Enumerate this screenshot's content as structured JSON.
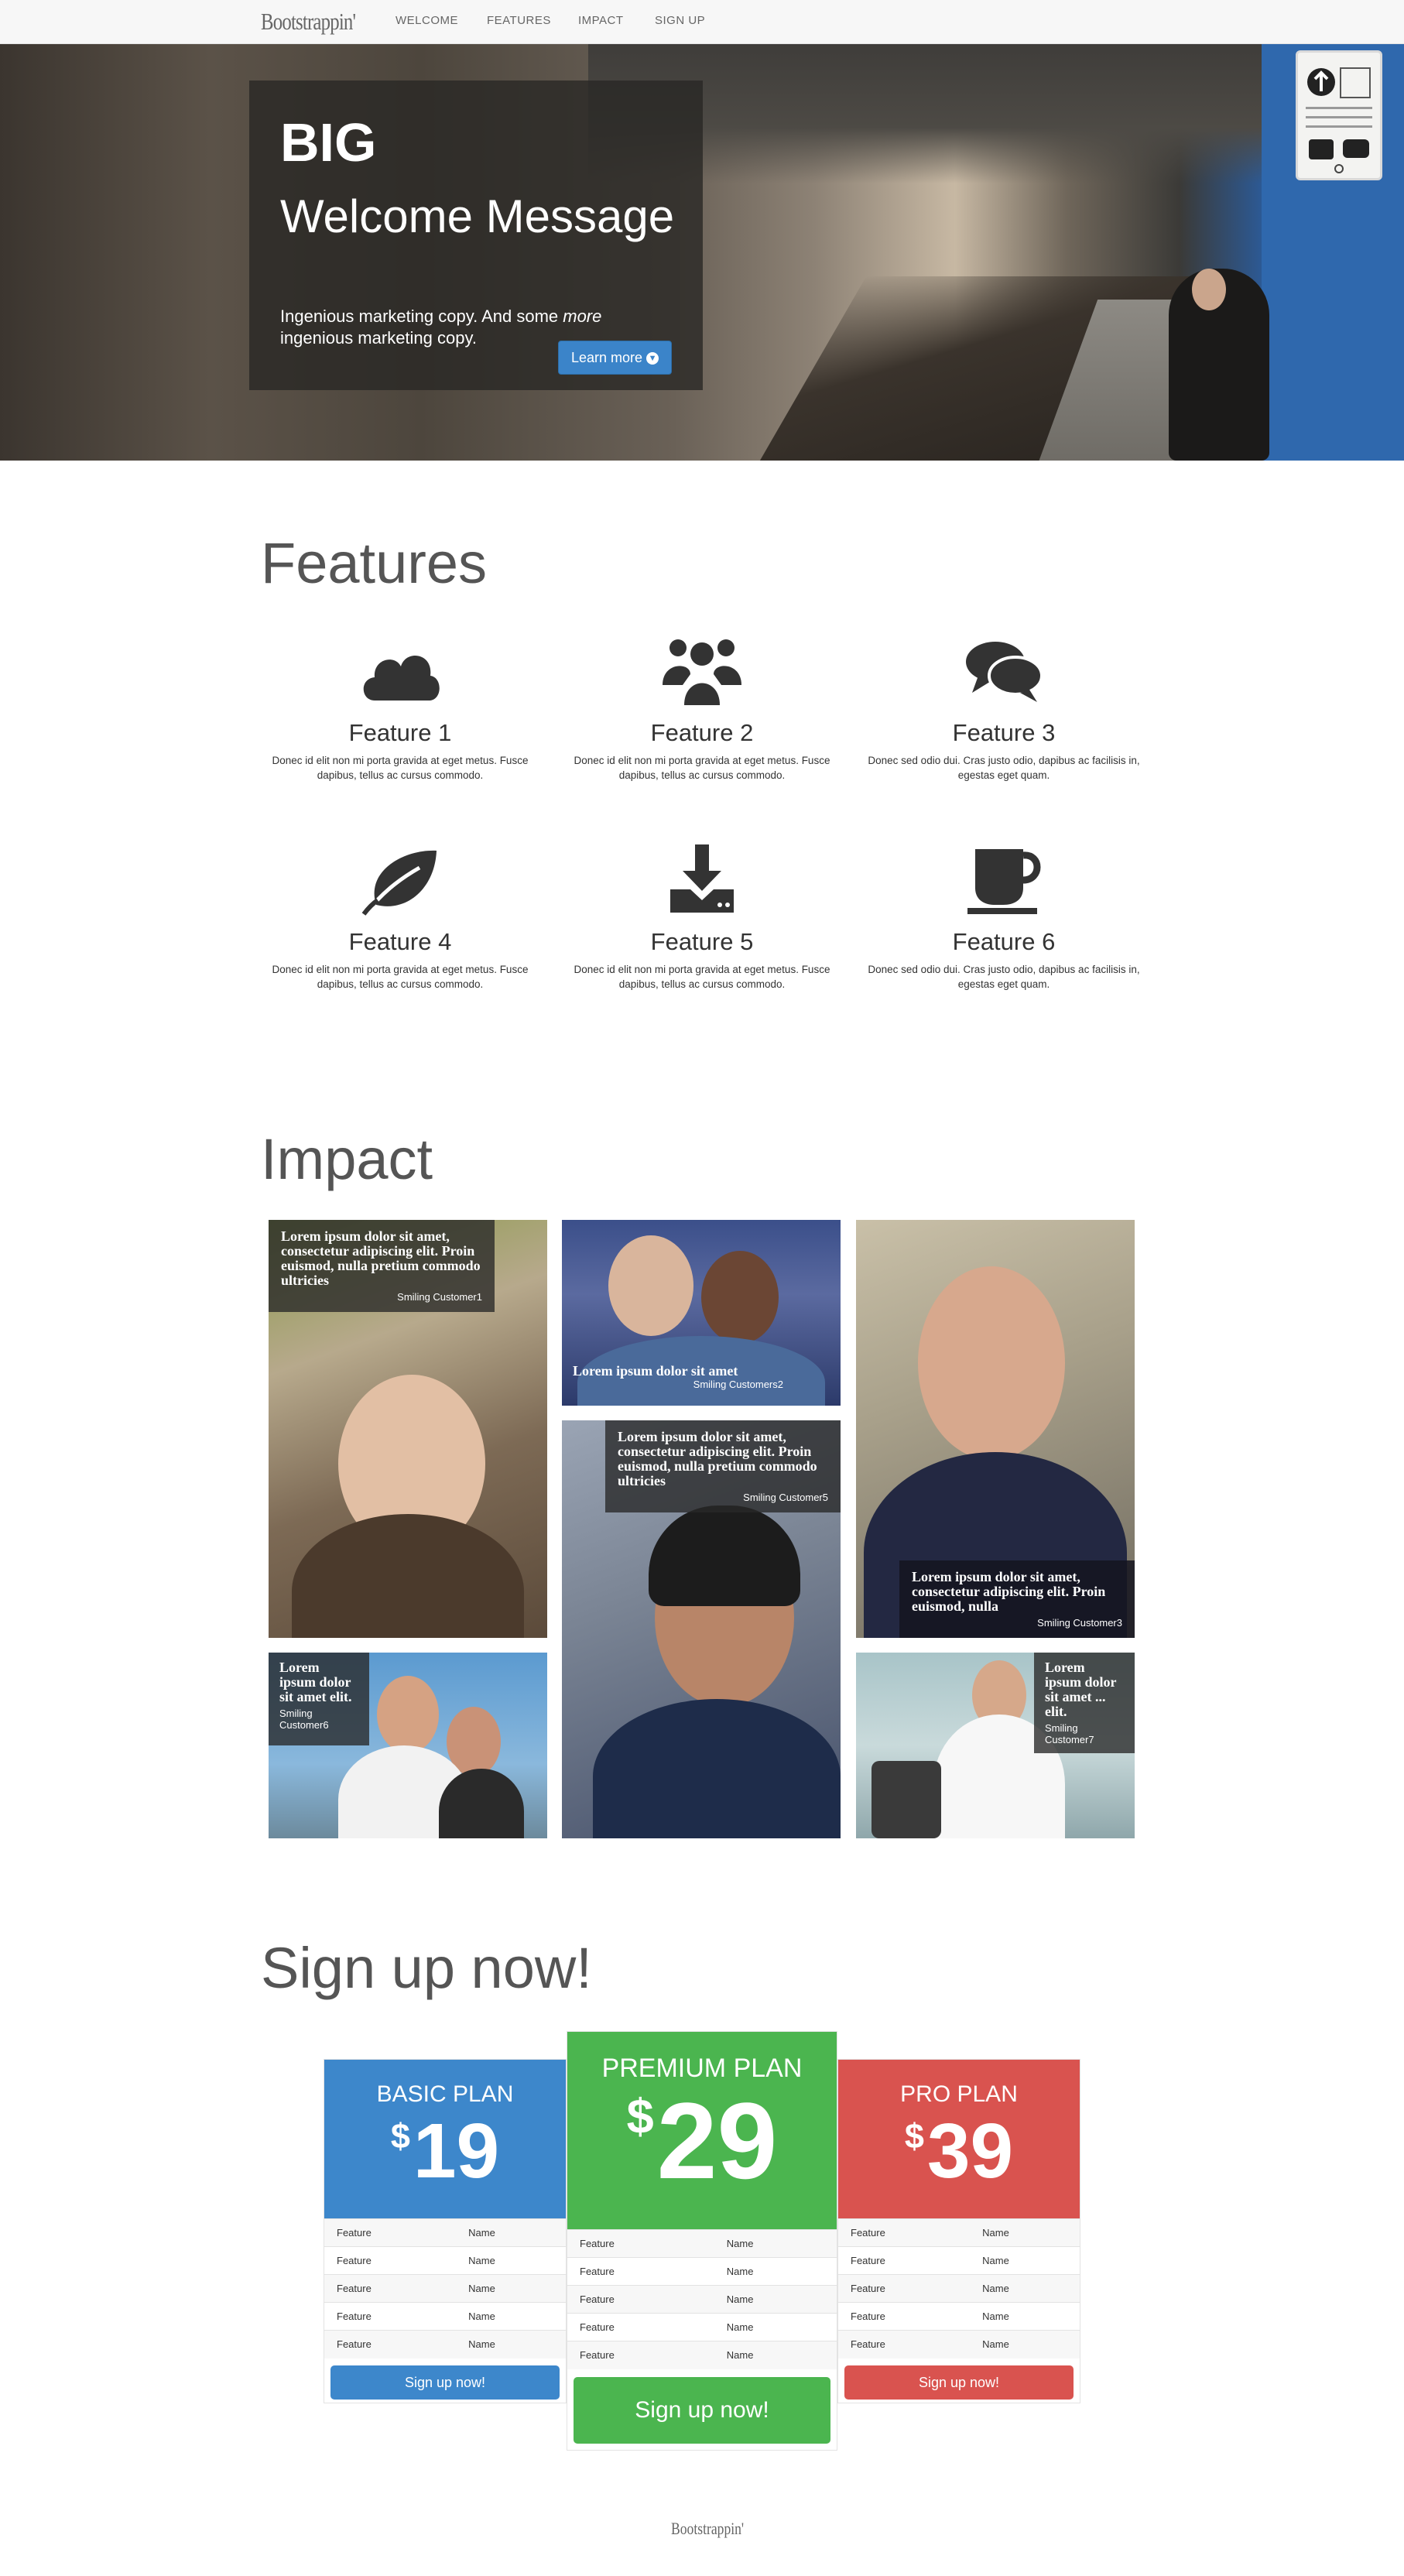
{
  "nav": {
    "brand": "Bootstrappin'",
    "links": [
      "WELCOME",
      "FEATURES",
      "IMPACT",
      "SIGN UP"
    ]
  },
  "hero": {
    "headline_big": "BIG",
    "headline_rest": "Welcome Message",
    "copy_before": "Ingenious marketing copy. And some ",
    "copy_em": "more",
    "copy_after": " ingenious marketing copy.",
    "button": "Learn more",
    "button_icon": "chevron-circle-down-icon"
  },
  "features": {
    "title": "Features",
    "items": [
      {
        "title": "Feature 1",
        "icon": "cloud-icon",
        "desc": "Donec id elit non mi porta gravida at eget metus. Fusce dapibus, tellus ac cursus commodo."
      },
      {
        "title": "Feature 2",
        "icon": "group-icon",
        "desc": "Donec id elit non mi porta gravida at eget metus. Fusce dapibus, tellus ac cursus commodo."
      },
      {
        "title": "Feature 3",
        "icon": "comments-icon",
        "desc": "Donec sed odio dui. Cras justo odio, dapibus ac facilisis in, egestas eget quam."
      },
      {
        "title": "Feature 4",
        "icon": "leaf-icon",
        "desc": "Donec id elit non mi porta gravida at eget metus. Fusce dapibus, tellus ac cursus commodo."
      },
      {
        "title": "Feature 5",
        "icon": "download-icon",
        "desc": "Donec id elit non mi porta gravida at eget metus. Fusce dapibus, tellus ac cursus commodo."
      },
      {
        "title": "Feature 6",
        "icon": "coffee-icon",
        "desc": "Donec sed odio dui. Cras justo odio, dapibus ac facilisis in, egestas eget quam."
      }
    ]
  },
  "impact": {
    "title": "Impact",
    "items": [
      {
        "text": "Lorem ipsum dolor sit amet, consectetur adipiscing elit. Proin euismod, nulla pretium commodo ultricies",
        "name": "Smiling Customer1"
      },
      {
        "text": "Lorem ipsum dolor sit amet",
        "name": "Smiling Customers2"
      },
      {
        "text": "Lorem ipsum dolor sit amet, consectetur adipiscing elit. Proin euismod, nulla",
        "name": "Smiling Customer3"
      },
      {
        "text": "Lorem ipsum dolor sit amet, consectetur adipiscing elit. Proin euismod, nulla pretium commodo ultricies",
        "name": "Smiling Customer5"
      },
      {
        "text": "Lorem ipsum dolor sit amet elit.",
        "name": "Smiling Customer6"
      },
      {
        "text": "Lorem ipsum dolor sit amet ... elit.",
        "name": "Smiling Customer7"
      }
    ]
  },
  "signup": {
    "title": "Sign up now!",
    "plans": [
      {
        "name": "BASIC PLAN",
        "currency": "$",
        "price": "19",
        "color": "#3d87cb",
        "button": "Sign up now!"
      },
      {
        "name": "PREMIUM PLAN",
        "currency": "$",
        "price": "29",
        "color": "#4bb54f",
        "button": "Sign up now!"
      },
      {
        "name": "PRO PLAN",
        "currency": "$",
        "price": "39",
        "color": "#d9534f",
        "button": "Sign up now!"
      }
    ],
    "row_label": "Feature",
    "row_value": "Name"
  },
  "footer": {
    "brand": "Bootstrappin'"
  }
}
